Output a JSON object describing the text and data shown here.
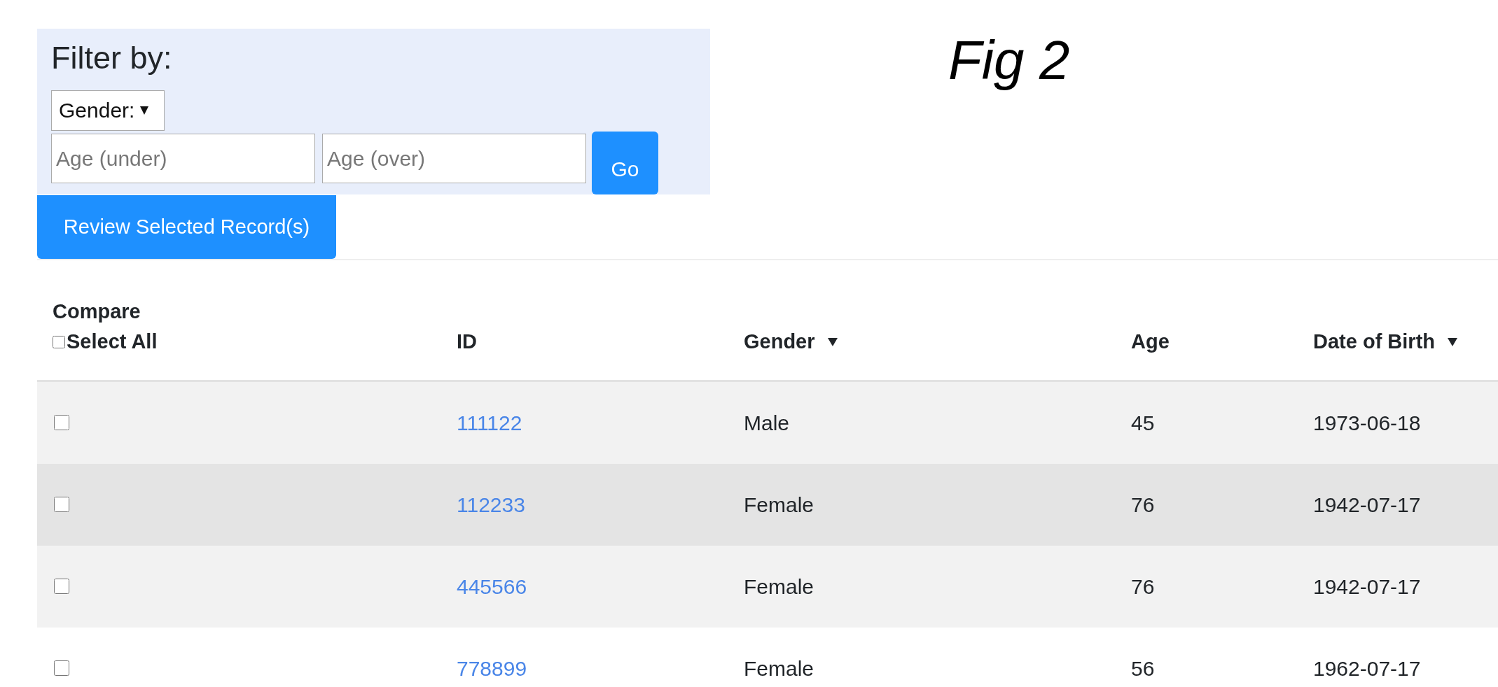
{
  "filter": {
    "title": "Filter by:",
    "gender_select": {
      "label": "Gender:"
    },
    "age_under": {
      "placeholder": "Age (under)"
    },
    "age_over": {
      "placeholder": "Age (over)"
    },
    "go_button": "Go"
  },
  "review_button": "Review Selected Record(s)",
  "figure_label": "Fig 2",
  "table": {
    "compare_heading": "Compare",
    "select_all": {
      "label": "Select All",
      "checked": false
    },
    "columns": [
      {
        "label": "ID",
        "sorted": false
      },
      {
        "label": "Gender",
        "sorted": true
      },
      {
        "label": "Age",
        "sorted": false
      },
      {
        "label": "Date of Birth",
        "sorted": true
      }
    ],
    "rows": [
      {
        "checked": false,
        "highlighted": false,
        "id": "111122",
        "gender": "Male",
        "age": "45",
        "dob": "1973-06-18"
      },
      {
        "checked": false,
        "highlighted": true,
        "id": "112233",
        "gender": "Female",
        "age": "76",
        "dob": "1942-07-17"
      },
      {
        "checked": false,
        "highlighted": false,
        "id": "445566",
        "gender": "Female",
        "age": "76",
        "dob": "1942-07-17"
      },
      {
        "checked": false,
        "highlighted": false,
        "id": "778899",
        "gender": "Female",
        "age": "56",
        "dob": "1962-07-17"
      }
    ]
  }
}
